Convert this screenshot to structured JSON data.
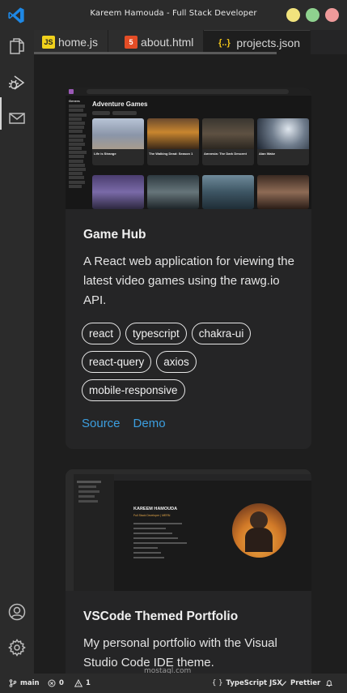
{
  "window": {
    "title": "Kareem Hamouda - Full Stack Developer",
    "dots": [
      "#f1e37d",
      "#8fd28f",
      "#ef9a9a"
    ]
  },
  "activity_bar": {
    "items": [
      "files-icon",
      "run-debug-icon",
      "mail-icon"
    ],
    "bottom": [
      "account-icon",
      "settings-gear-icon"
    ]
  },
  "tabs": [
    {
      "label": "home.js",
      "icon": "js-icon",
      "icon_text": "JS",
      "icon_bg": "#f0d11c"
    },
    {
      "label": "about.html",
      "icon": "html5-icon",
      "icon_text": "5",
      "icon_bg": "#e44d26"
    },
    {
      "label": "projects.json",
      "icon": "json-icon",
      "icon_text": "{..}",
      "icon_bg": "#f0c419",
      "active": true
    }
  ],
  "projects": [
    {
      "title": "Game Hub",
      "description": "A React web application for viewing the latest video games using the rawg.io API.",
      "tags": [
        "react",
        "typescript",
        "chakra-ui",
        "react-query",
        "axios",
        "mobile-responsive"
      ],
      "source_label": "Source",
      "demo_label": "Demo",
      "screenshot": {
        "heading": "Adventure Games",
        "sidebar_heading": "Genres",
        "games": [
          "Life is Strange",
          "The Walking Dead: Season 1",
          "Amnesia: The Dark Descent",
          "Alan Wake"
        ]
      }
    },
    {
      "title": "VSCode Themed Portfolio",
      "description": "My personal portfolio with the Visual Studio Code IDE theme.",
      "screenshot": {
        "name": "KAREEM HAMOUDA",
        "role": "Full Stack Developer | MERN"
      }
    }
  ],
  "status_bar": {
    "branch": "main",
    "errors": "0",
    "warnings": "1",
    "language": "TypeScript JSX",
    "formatter": "Prettier"
  },
  "watermark": "mostaql.com",
  "colors": {
    "accent_link": "#3c9fe0",
    "background": "#1e1e1e",
    "card": "#252526"
  }
}
